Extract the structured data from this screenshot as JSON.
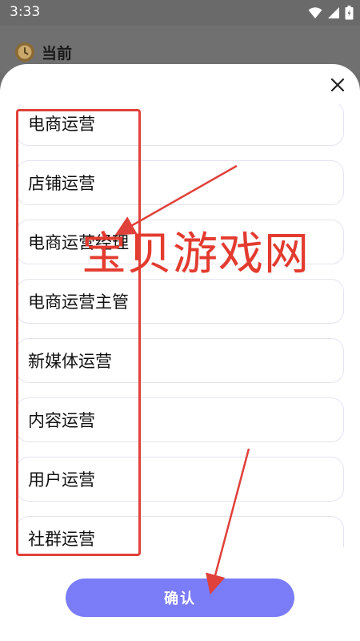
{
  "status_bar": {
    "time": "3:33",
    "icons": [
      "wifi-icon",
      "signal-icon",
      "battery-icon"
    ]
  },
  "header": {
    "icon": "clock-icon",
    "title": "当前"
  },
  "sheet": {
    "close_icon": "close-icon",
    "options": [
      {
        "label": "电商运营"
      },
      {
        "label": "店铺运营"
      },
      {
        "label": "电商运营经理"
      },
      {
        "label": "电商运营主管"
      },
      {
        "label": "新媒体运营"
      },
      {
        "label": "内容运营"
      },
      {
        "label": "用户运营"
      },
      {
        "label": "社群运营"
      }
    ],
    "confirm_label": "确认"
  },
  "overlay": {
    "watermark": "宝贝游戏网"
  },
  "colors": {
    "accent": "#7b7cf7",
    "annotation": "#e0413a",
    "backdrop": "#6d6d6d"
  }
}
